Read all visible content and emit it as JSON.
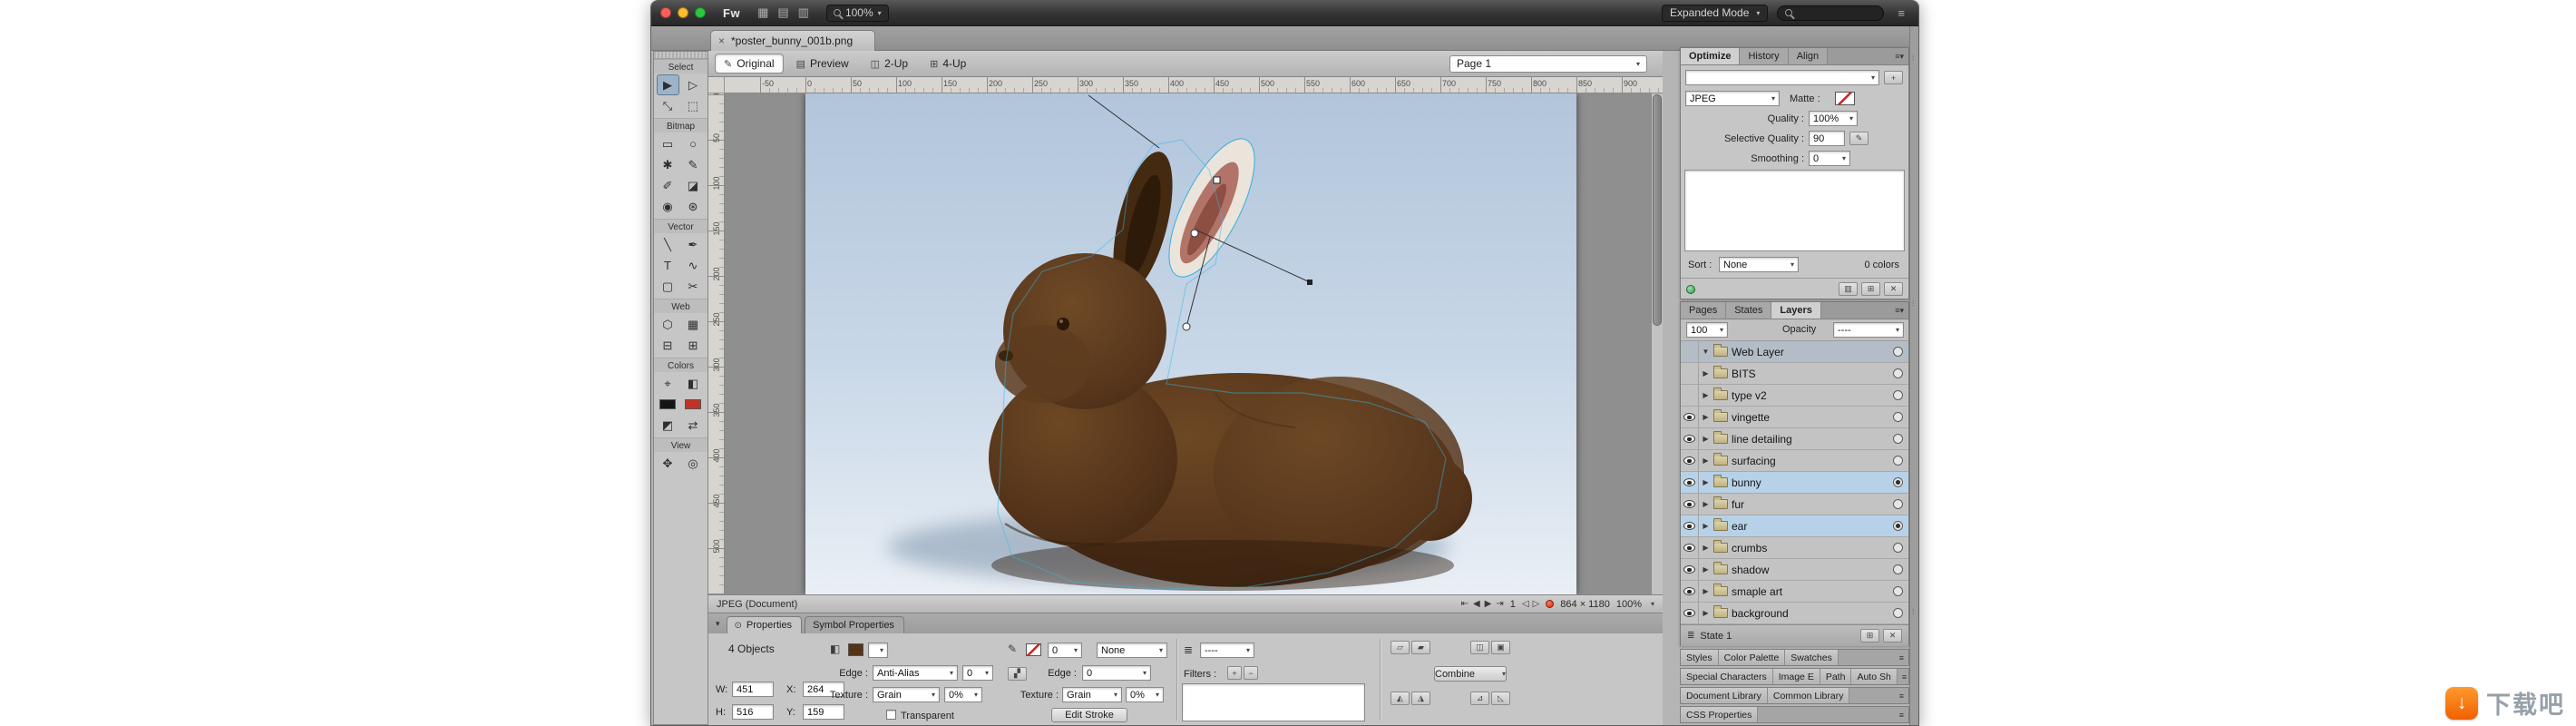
{
  "menu_bar": {
    "logo": "Fw",
    "icons": [
      "▦",
      "▤",
      "▥"
    ],
    "zoom": "100%",
    "mode": "Expanded Mode",
    "menu_icon": "≡"
  },
  "doc_tab": {
    "close": "×",
    "title": "*poster_bunny_001b.png"
  },
  "view_bar": {
    "modes": [
      {
        "label": "Original",
        "glyph": "✎",
        "active": true
      },
      {
        "label": "Preview",
        "glyph": "▤",
        "active": false
      },
      {
        "label": "2-Up",
        "glyph": "◫",
        "active": false
      },
      {
        "label": "4-Up",
        "glyph": "⊞",
        "active": false
      }
    ],
    "page": "Page 1"
  },
  "tools": {
    "sections": [
      {
        "label": "Select",
        "tools": [
          {
            "name": "pointer-tool",
            "glyph": "▶",
            "active": true
          },
          {
            "name": "subselection-tool",
            "glyph": "▷"
          },
          {
            "name": "scale-tool",
            "glyph": "⤡"
          },
          {
            "name": "crop-tool",
            "glyph": "⬚"
          }
        ]
      },
      {
        "label": "Bitmap",
        "tools": [
          {
            "name": "marquee-tool",
            "glyph": "▭"
          },
          {
            "name": "lasso-tool",
            "glyph": "○"
          },
          {
            "name": "magic-wand-tool",
            "glyph": "✱"
          },
          {
            "name": "brush-tool",
            "glyph": "✎"
          },
          {
            "name": "pencil-tool",
            "glyph": "✐"
          },
          {
            "name": "eraser-tool",
            "glyph": "◪"
          },
          {
            "name": "blur-tool",
            "glyph": "◉"
          },
          {
            "name": "rubber-stamp-tool",
            "glyph": "⊛"
          }
        ]
      },
      {
        "label": "Vector",
        "tools": [
          {
            "name": "line-tool",
            "glyph": "╲"
          },
          {
            "name": "pen-tool",
            "glyph": "✒"
          },
          {
            "name": "text-tool",
            "glyph": "T"
          },
          {
            "name": "freeform-tool",
            "glyph": "∿"
          },
          {
            "name": "rectangle-tool",
            "glyph": "▢"
          },
          {
            "name": "knife-tool",
            "glyph": "✂"
          }
        ]
      },
      {
        "label": "Web",
        "tools": [
          {
            "name": "polygon-hotspot-tool",
            "glyph": "⬡"
          },
          {
            "name": "slice-tool",
            "glyph": "▦"
          },
          {
            "name": "hide-slices-button",
            "glyph": "⊟"
          },
          {
            "name": "show-slices-button",
            "glyph": "⊞"
          }
        ]
      },
      {
        "label": "Colors",
        "tools": [
          {
            "name": "eyedropper-tool",
            "glyph": "⌖"
          },
          {
            "name": "paint-bucket-tool",
            "glyph": "◧"
          },
          {
            "name": "stroke-color-well",
            "swatch": "#151515"
          },
          {
            "name": "fill-color-well",
            "swatch": "#c03226"
          },
          {
            "name": "default-colors-button",
            "glyph": "◩"
          },
          {
            "name": "swap-colors-button",
            "glyph": "⇄"
          }
        ]
      },
      {
        "label": "View",
        "tools": [
          {
            "name": "hand-tool",
            "glyph": "✥"
          },
          {
            "name": "zoom-tool",
            "glyph": "◎"
          }
        ]
      }
    ]
  },
  "rulers": {
    "horizontal": [
      "-50",
      "0",
      "50",
      "100",
      "150",
      "200",
      "250",
      "300",
      "350",
      "400",
      "450",
      "500",
      "550",
      "600",
      "650",
      "700",
      "750",
      "800",
      "850",
      "900"
    ],
    "vertical": [
      "0",
      "50",
      "100",
      "150",
      "200",
      "250",
      "300",
      "350",
      "400",
      "450",
      "500"
    ]
  },
  "status_bar": {
    "doc_label": "JPEG (Document)",
    "transport": [
      "⇤",
      "◀",
      "▶",
      "⇥"
    ],
    "page_num": "1",
    "nav2": [
      "◁",
      "▷"
    ],
    "canvas_size": "864 × 1180",
    "zoom": "100%"
  },
  "properties": {
    "tabs": [
      {
        "label": "Properties",
        "active": true
      },
      {
        "label": "Symbol Properties",
        "active": false
      }
    ],
    "selection": "4 Objects",
    "w_label": "W:",
    "w": "451",
    "h_label": "H:",
    "h": "516",
    "x_label": "X:",
    "x": "264",
    "y_label": "Y:",
    "y": "159",
    "fill": {
      "edge_label": "Edge :",
      "edge": "Anti-Alias",
      "edge_amount": "0",
      "texture_label": "Texture :",
      "texture": "Grain",
      "texture_amount": "0%",
      "transparent": "Transparent"
    },
    "stroke": {
      "size": "0",
      "category": "None",
      "edge_label": "Edge :",
      "edge": "0",
      "texture_label": "Texture :",
      "texture": "Grain",
      "texture_amount": "0%",
      "edit": "Edit Stroke"
    },
    "filters": {
      "label": "Filters :",
      "plus": "+",
      "minus": "−",
      "blend": "----"
    },
    "combine": "Combine",
    "icon_glyphs": [
      "▱",
      "▰",
      "◫",
      "▣",
      "◭",
      "◮",
      "⊿",
      "◺"
    ]
  },
  "optimize": {
    "tabs": [
      {
        "label": "Optimize",
        "active": true
      },
      {
        "label": "History",
        "active": false
      },
      {
        "label": "Align",
        "active": false
      }
    ],
    "preset": "",
    "format": "JPEG",
    "matte_label": "Matte :",
    "quality_label": "Quality :",
    "quality": "100%",
    "selective_label": "Selective Quality :",
    "selective": "90",
    "smoothing_label": "Smoothing :",
    "smoothing": "0",
    "sort_label": "Sort :",
    "sort": "None",
    "colors_count": "0 colors",
    "bottom_icons": [
      "▥",
      "⊞",
      "✕"
    ]
  },
  "layers_panel": {
    "tabs": [
      {
        "label": "Pages",
        "active": false
      },
      {
        "label": "States",
        "active": false
      },
      {
        "label": "Layers",
        "active": true
      }
    ],
    "opacity_value": "100",
    "opacity_label": "Opacity",
    "blend_value": "----",
    "rows": [
      {
        "name": "Web Layer",
        "eye": false,
        "expand": "▼",
        "selected": false,
        "web": true,
        "target": false
      },
      {
        "name": "BITS",
        "eye": false,
        "expand": "▶"
      },
      {
        "name": "type v2",
        "eye": false,
        "expand": "▶"
      },
      {
        "name": "vingette",
        "eye": true,
        "expand": "▶"
      },
      {
        "name": "line detailing",
        "eye": true,
        "expand": "▶"
      },
      {
        "name": "surfacing",
        "eye": true,
        "expand": "▶"
      },
      {
        "name": "bunny",
        "eye": true,
        "expand": "▶",
        "selected": true,
        "target": true
      },
      {
        "name": "fur",
        "eye": true,
        "expand": "▶"
      },
      {
        "name": "ear",
        "eye": true,
        "expand": "▶",
        "selected": true,
        "target": true
      },
      {
        "name": "crumbs",
        "eye": true,
        "expand": "▶"
      },
      {
        "name": "shadow",
        "eye": true,
        "expand": "▶"
      },
      {
        "name": "smaple art",
        "eye": true,
        "expand": "▶"
      },
      {
        "name": "background",
        "eye": true,
        "expand": "▶"
      }
    ],
    "state_bar": {
      "label": "State 1",
      "icons": [
        "⊞",
        "✕"
      ]
    }
  },
  "collapsed_panels": [
    {
      "tabs": [
        "Styles",
        "Color Palette",
        "Swatches"
      ]
    },
    {
      "tabs": [
        "Special Characters",
        "Image E",
        "Path",
        "Auto Sh"
      ]
    },
    {
      "tabs": [
        "Document Library",
        "Common Library"
      ]
    },
    {
      "tabs": [
        "CSS Properties"
      ]
    }
  ],
  "watermark": {
    "site_name": "下载吧",
    "logo_glyph": "↓"
  }
}
